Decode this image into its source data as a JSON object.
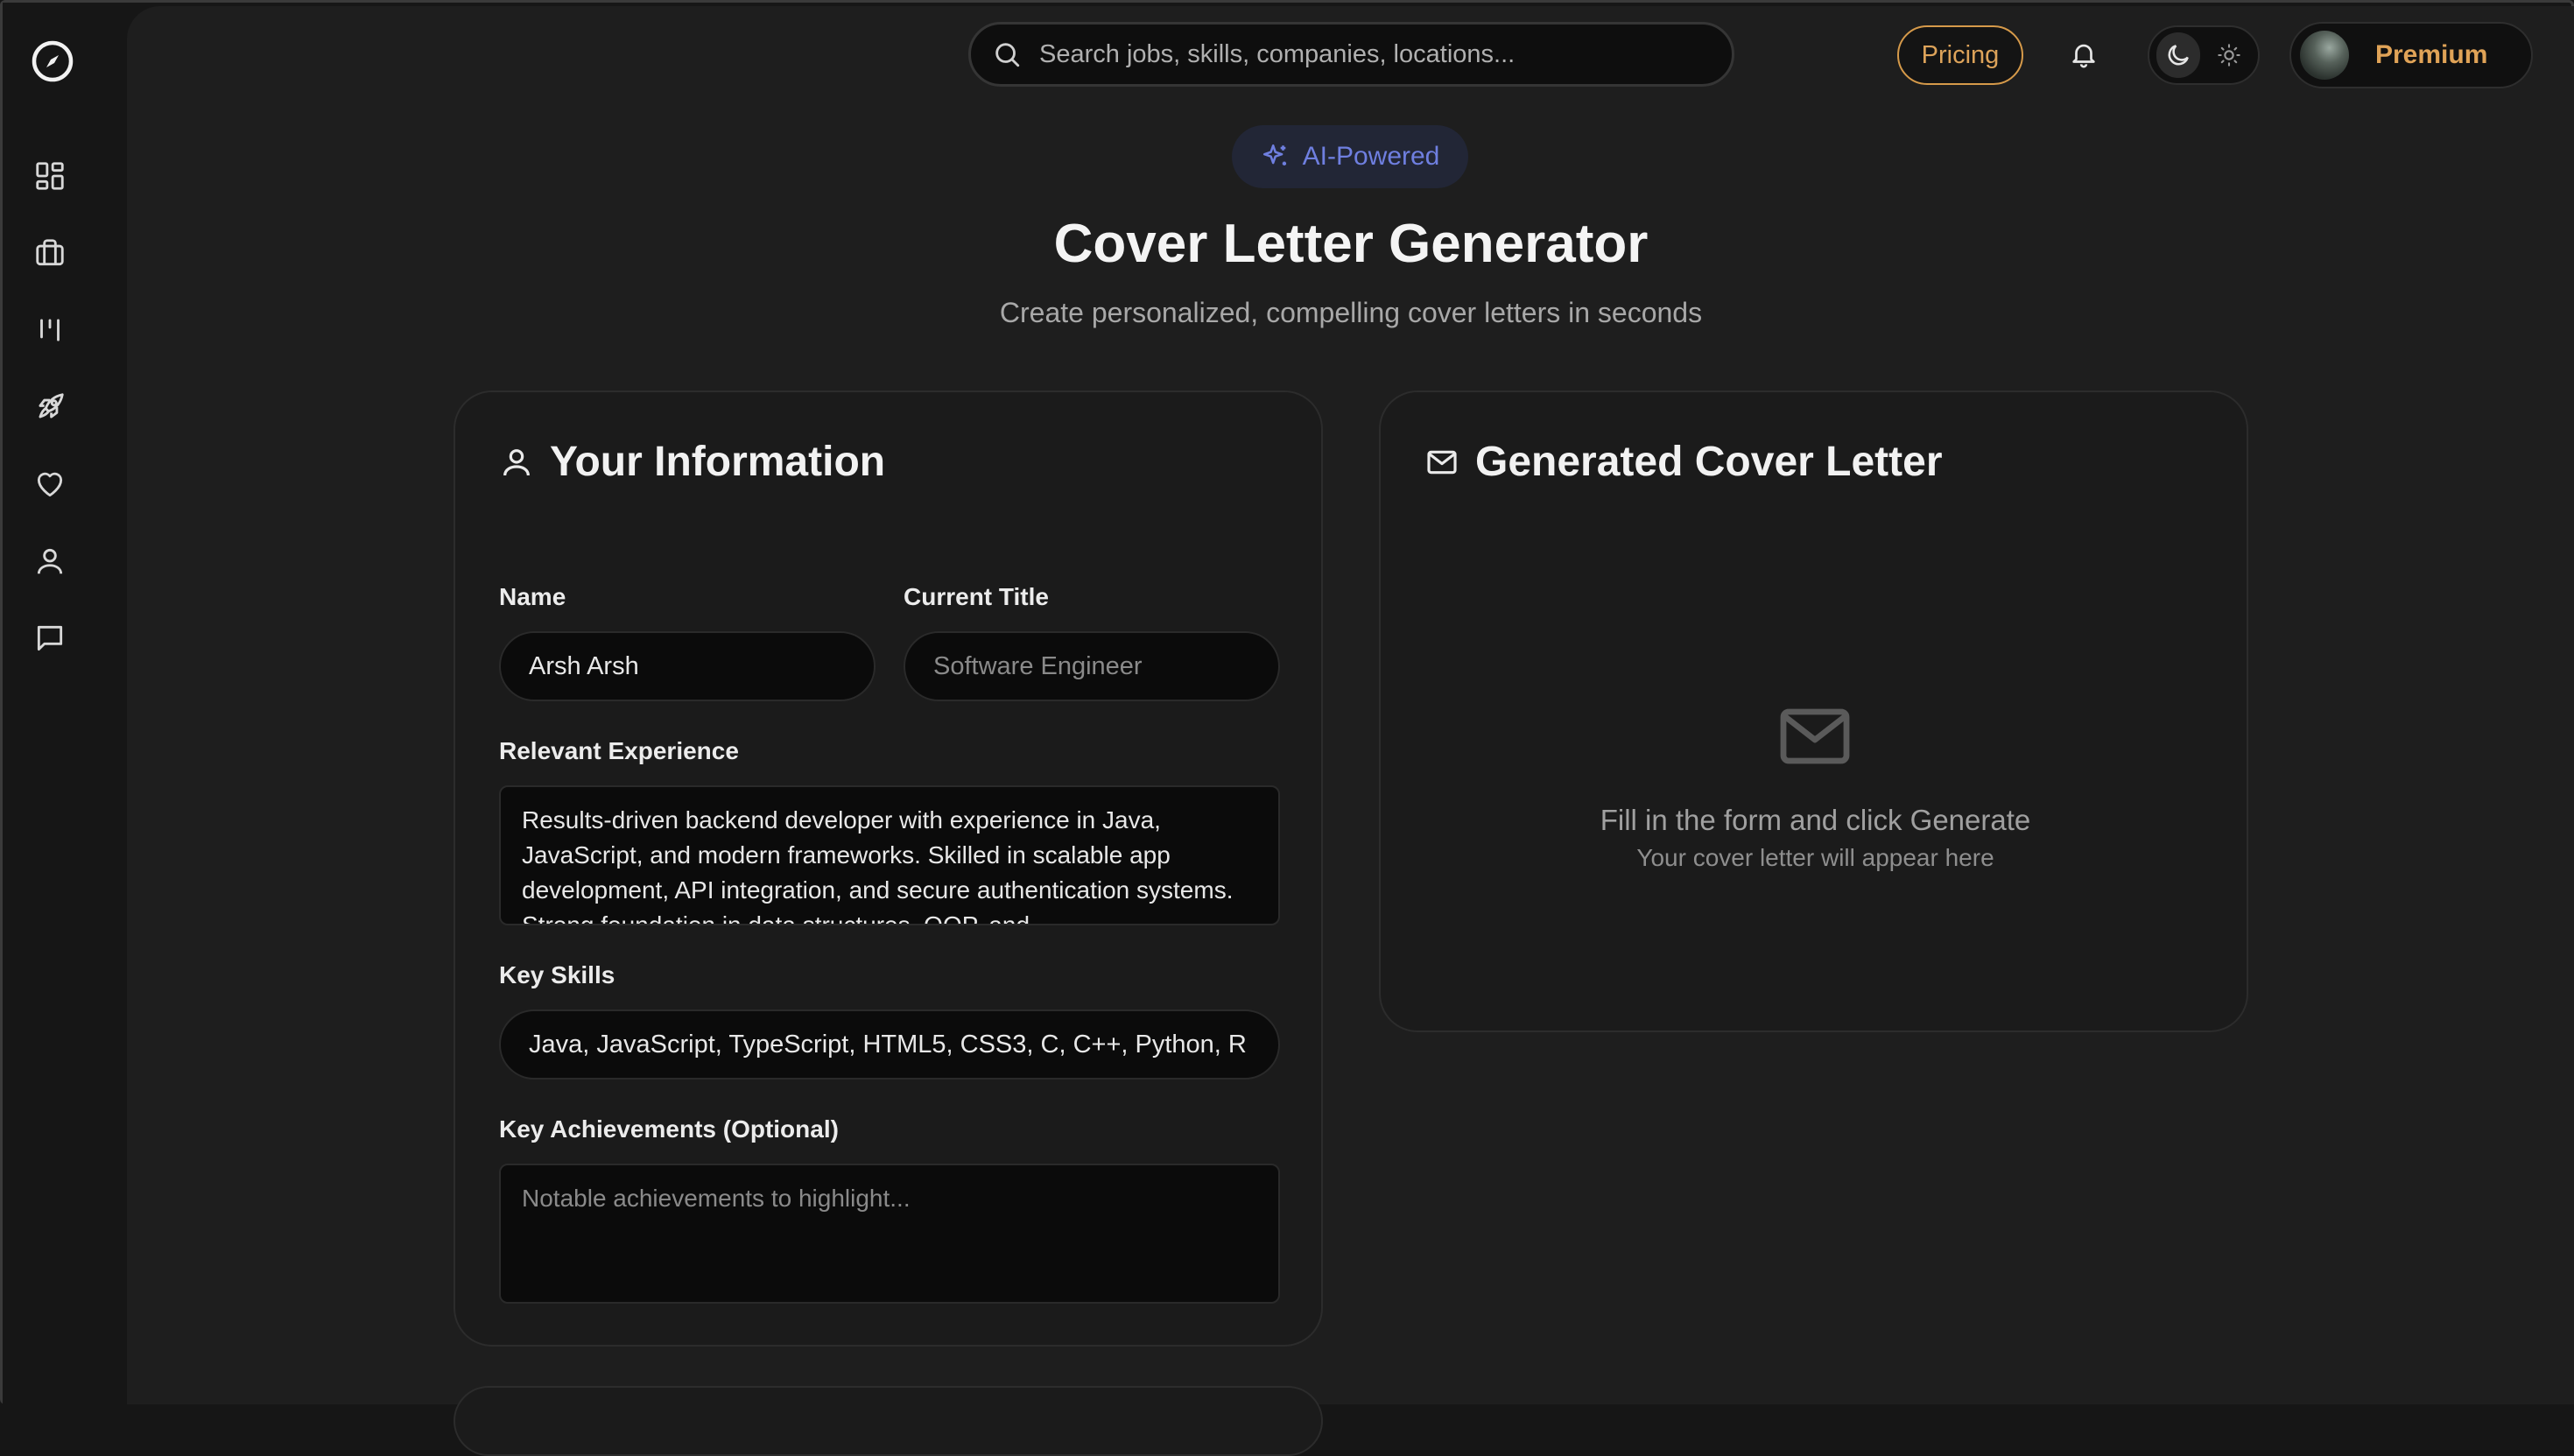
{
  "header": {
    "search_placeholder": "Search jobs, skills, companies, locations...",
    "pricing_label": "Pricing",
    "premium_label": "Premium"
  },
  "sidebar": {
    "items": [
      {
        "name": "dashboard",
        "icon": "grid-icon"
      },
      {
        "name": "jobs",
        "icon": "briefcase-icon"
      },
      {
        "name": "board",
        "icon": "kanban-icon"
      },
      {
        "name": "launch",
        "icon": "rocket-icon"
      },
      {
        "name": "favorites",
        "icon": "heart-icon"
      },
      {
        "name": "profile",
        "icon": "user-icon"
      },
      {
        "name": "messages",
        "icon": "chat-icon"
      }
    ]
  },
  "hero": {
    "badge": "AI-Powered",
    "title": "Cover Letter Generator",
    "subtitle": "Create personalized, compelling cover letters in seconds"
  },
  "form": {
    "heading": "Your Information",
    "name_label": "Name",
    "name_value": "Arsh Arsh",
    "title_label": "Current Title",
    "title_placeholder": "Software Engineer",
    "experience_label": "Relevant Experience",
    "experience_value": "Results-driven backend developer with experience in Java, JavaScript, and modern frameworks. Skilled in scalable app development, API integration, and secure authentication systems. Strong foundation in data structures, OOP, and",
    "skills_label": "Key Skills",
    "skills_value": "Java, JavaScript, TypeScript, HTML5, CSS3, C, C++, Python, R",
    "achievements_label": "Key Achievements (Optional)",
    "achievements_placeholder": "Notable achievements to highlight..."
  },
  "output": {
    "heading": "Generated Cover Letter",
    "empty_title": "Fill in the form and click Generate",
    "empty_subtitle": "Your cover letter will appear here"
  },
  "colors": {
    "accent_orange": "#dda35a",
    "accent_indigo": "#6f7fe0"
  }
}
